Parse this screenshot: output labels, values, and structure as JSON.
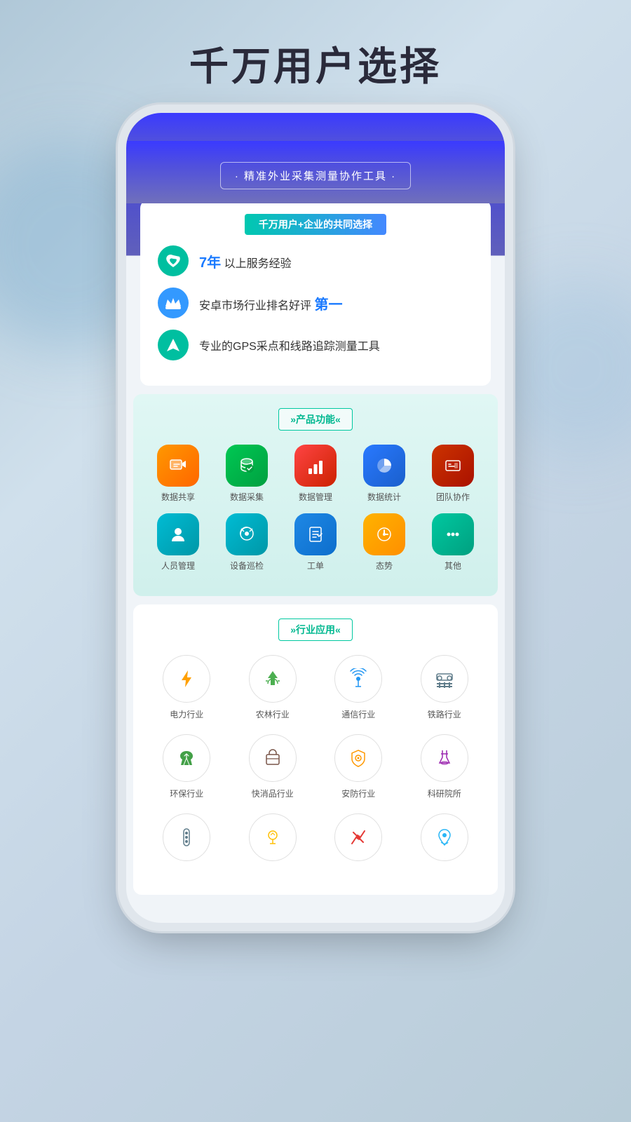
{
  "page": {
    "title": "千万用户选择",
    "bg_color": "#c8d8e8"
  },
  "phone": {
    "tagline": "精准外业采集测量协作工具",
    "stats_title": "千万用户+企业的共同选择",
    "stats": [
      {
        "icon": "heart-shield",
        "text_before": "",
        "highlight": "7年",
        "text_after": " 以上服务经验",
        "icon_color": "teal"
      },
      {
        "icon": "crown",
        "text_before": "安卓市场行业排名好评 ",
        "highlight": "第一",
        "text_after": "",
        "icon_color": "blue"
      },
      {
        "icon": "location",
        "text_before": "专业的GPS采点和线路追踪测量工具",
        "highlight": "",
        "text_after": "",
        "icon_color": "teal"
      }
    ],
    "product_section": {
      "title": "»产品功能«",
      "functions": [
        {
          "label": "数据共享",
          "icon": "chart-share",
          "color": "orange"
        },
        {
          "label": "数据采集",
          "icon": "database-search",
          "color": "green-dark"
        },
        {
          "label": "数据管理",
          "icon": "bar-chart",
          "color": "red"
        },
        {
          "label": "数据统计",
          "icon": "pie-chart",
          "color": "blue"
        },
        {
          "label": "团队协作",
          "icon": "team",
          "color": "red-dark"
        },
        {
          "label": "人员管理",
          "icon": "person",
          "color": "teal"
        },
        {
          "label": "设备巡检",
          "icon": "shield-check",
          "color": "teal"
        },
        {
          "label": "工单",
          "icon": "form",
          "color": "blue-teal"
        },
        {
          "label": "态势",
          "icon": "gauge",
          "color": "amber"
        },
        {
          "label": "其他",
          "icon": "more",
          "color": "green-teal"
        }
      ]
    },
    "industry_section": {
      "title": "»行业应用«",
      "industries": [
        {
          "label": "电力行业",
          "icon": "⚡",
          "color": "#ffa000"
        },
        {
          "label": "农林行业",
          "icon": "🌲",
          "color": "#4caf50"
        },
        {
          "label": "通信行业",
          "icon": "📡",
          "color": "#2196f3"
        },
        {
          "label": "铁路行业",
          "icon": "🛤",
          "color": "#607d8b"
        },
        {
          "label": "环保行业",
          "icon": "♻",
          "color": "#43a047"
        },
        {
          "label": "快消品行业",
          "icon": "📦",
          "color": "#795548"
        },
        {
          "label": "安防行业",
          "icon": "🛡",
          "color": "#ff9800"
        },
        {
          "label": "科研院所",
          "icon": "🔬",
          "color": "#9c27b0"
        },
        {
          "label": "",
          "icon": "🔧",
          "color": "#607d8b"
        },
        {
          "label": "",
          "icon": "💡",
          "color": "#ffc107"
        },
        {
          "label": "",
          "icon": "✂",
          "color": "#e53935"
        },
        {
          "label": "",
          "icon": "💧",
          "color": "#29b6f6"
        }
      ]
    }
  }
}
